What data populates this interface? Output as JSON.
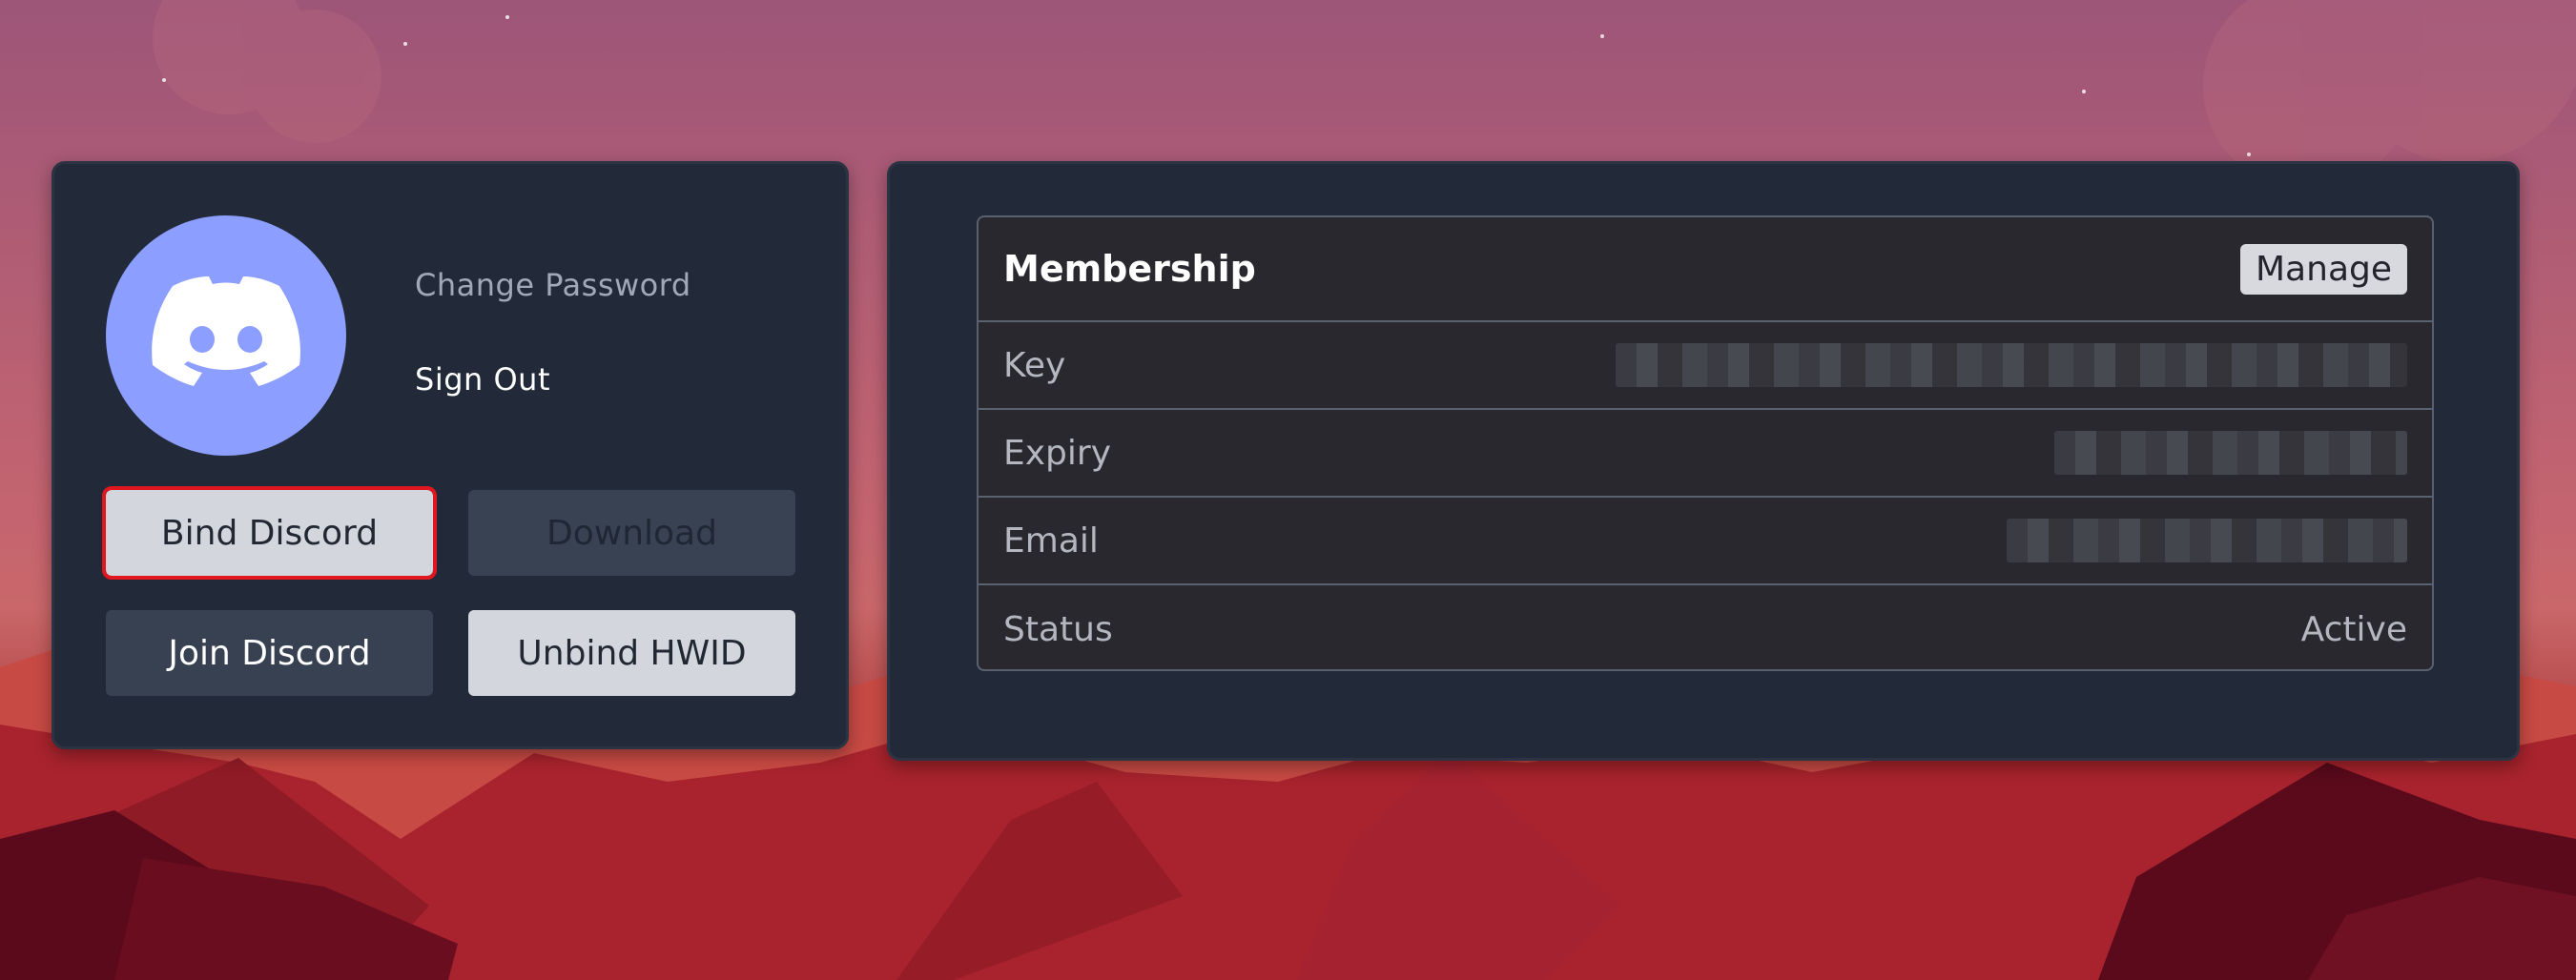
{
  "left_panel": {
    "change_password": "Change Password",
    "sign_out": "Sign Out",
    "buttons": {
      "bind_discord": "Bind Discord",
      "download": "Download",
      "join_discord": "Join Discord",
      "unbind_hwid": "Unbind HWID"
    }
  },
  "membership": {
    "title": "Membership",
    "manage_label": "Manage",
    "rows": [
      {
        "label": "Key",
        "value": ""
      },
      {
        "label": "Expiry",
        "value": ""
      },
      {
        "label": "Email",
        "value": ""
      },
      {
        "label": "Status",
        "value": "Active"
      }
    ]
  },
  "icons": {
    "avatar": "discord-logo-icon"
  },
  "colors": {
    "avatar_bg": "#8c9eff",
    "card_bg": "#222a39",
    "highlight_outline": "#e0171e"
  }
}
